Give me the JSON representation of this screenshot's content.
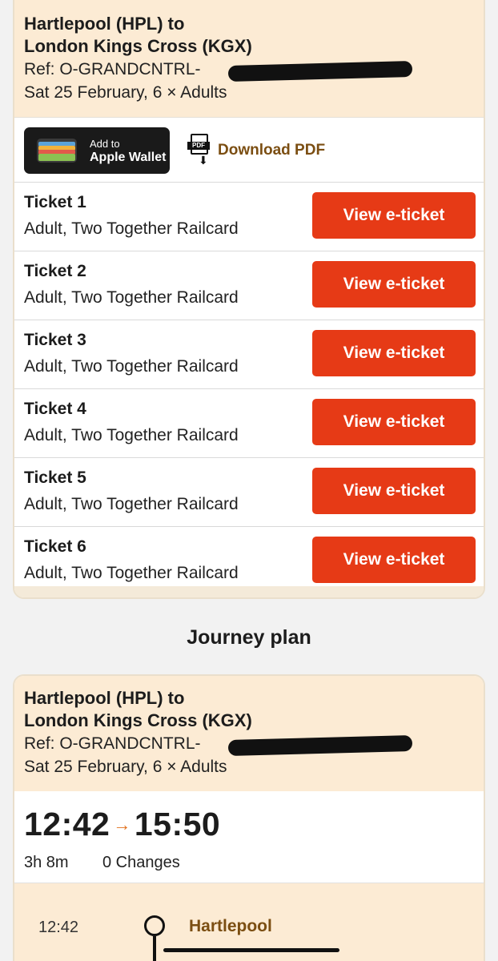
{
  "booking": {
    "route_line1": "Hartlepool (HPL) to",
    "route_line2": "London Kings Cross (KGX)",
    "ref": "Ref: O-GRANDCNTRL-",
    "date_passengers": "Sat 25 February, 6 × Adults"
  },
  "actions": {
    "wallet_small": "Add to",
    "wallet_big": "Apple Wallet",
    "pdf_icon_text": "PDF",
    "pdf_label": "Download PDF"
  },
  "tickets": [
    {
      "name": "Ticket 1",
      "type": "Adult, Two Together Railcard",
      "button": "View e-ticket"
    },
    {
      "name": "Ticket 2",
      "type": "Adult, Two Together Railcard",
      "button": "View e-ticket"
    },
    {
      "name": "Ticket 3",
      "type": "Adult, Two Together Railcard",
      "button": "View e-ticket"
    },
    {
      "name": "Ticket 4",
      "type": "Adult, Two Together Railcard",
      "button": "View e-ticket"
    },
    {
      "name": "Ticket 5",
      "type": "Adult, Two Together Railcard",
      "button": "View e-ticket"
    },
    {
      "name": "Ticket 6",
      "type": "Adult, Two Together Railcard",
      "button": "View e-ticket"
    }
  ],
  "journey_plan": {
    "title": "Journey plan",
    "depart": "12:42",
    "arrow": "→",
    "arrive": "15:50",
    "duration": "3h 8m",
    "changes": "0 Changes",
    "first_stop_time": "12:42",
    "first_stop_name": "Hartlepool"
  },
  "colors": {
    "accent_button": "#e63a16",
    "header_bg": "#fcebd4",
    "link_brown": "#7b4e12"
  }
}
